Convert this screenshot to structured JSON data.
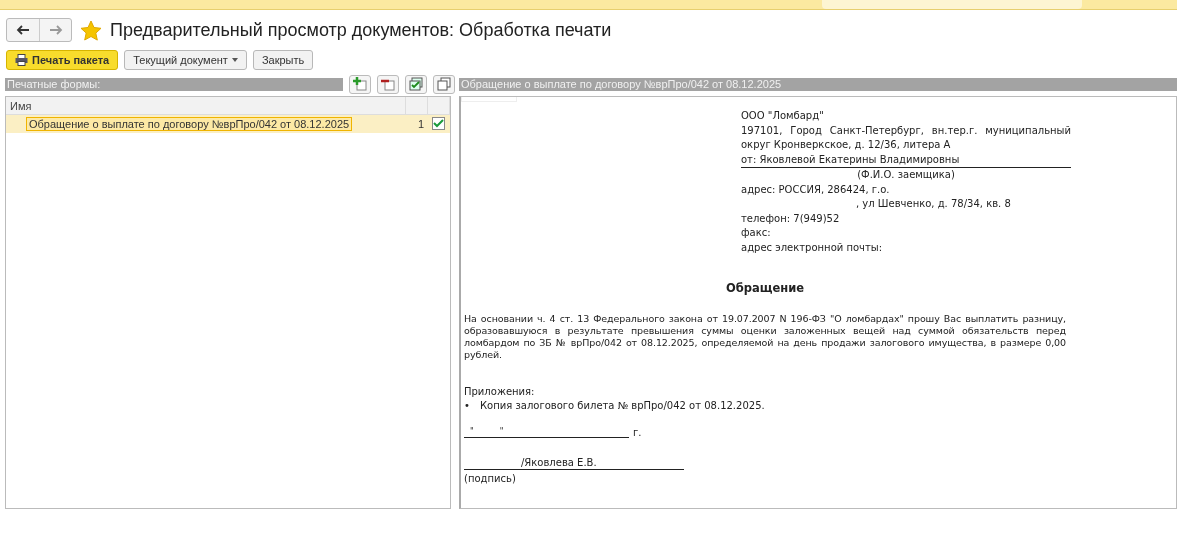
{
  "window": {
    "title": "Предварительный просмотр документов: Обработка печати",
    "favorite": true
  },
  "toolbar": [
    {
      "label": "Печать пакета",
      "kind": "primary"
    },
    {
      "label": "Текущий документ",
      "kind": "dropdown"
    },
    {
      "label": "Закрыть",
      "kind": "plain"
    }
  ],
  "forms_panel": {
    "title": "Печатные формы:",
    "columns": [
      "Имя"
    ],
    "rows": [
      {
        "name": "Обращение о выплате по договору №врПро/042 от 08.12.2025",
        "count": "1",
        "checked": true,
        "selected": true
      }
    ]
  },
  "preview": {
    "title": "Обращение о выплате по договору №врПро/042 от 08.12.2025",
    "header_lines": [
      {
        "text": "ООО \"Ломбард\"",
        "kind": "plain"
      },
      {
        "text": "197101, Город Санкт-Петербург, вн.тер.г. муниципальный округ Кронверкское, д. 12/36, литера А",
        "kind": "plain"
      },
      {
        "text": "от: Яковлевой Екатерины Владимировны",
        "kind": "underlined"
      },
      {
        "text": "(Ф.И.О. заемщика)",
        "kind": "caption"
      },
      {
        "text": "адрес: РОССИЯ, 286424, г.о.",
        "kind": "plain"
      },
      {
        "text": ", ул Шевченко, д. 78/34, кв. 8",
        "kind": "indent"
      },
      {
        "text": "телефон: 7(949)52",
        "kind": "plain"
      },
      {
        "text": "факс:",
        "kind": "plain"
      },
      {
        "text": "адрес электронной почты:",
        "kind": "plain"
      }
    ],
    "heading": "Обращение",
    "body": "На основании  ч. 4 ст. 13 Федерального закона от 19.07.2007 N 196-ФЗ \"О ломбардах\" прошу Вас  выплатить разницу, образовавшуюся в результате превышения суммы оценки заложенных вещей над суммой обязательств перед ломбардом по ЗБ № врПро/042 от 08.12.2025, определяемой на день продажи залогового имущества, в размере 0,00 рублей.",
    "attachments_label": "Приложения:",
    "attachments": [
      {
        "bullet": "•",
        "text": "Копия залогового билета № врПро/042 от 08.12.2025."
      }
    ],
    "date_quote_open": "\"",
    "date_quote_close": "\"",
    "date_suffix": "г.",
    "signer": "/Яковлева Е.В.",
    "signature_caption": "(подпись)"
  }
}
